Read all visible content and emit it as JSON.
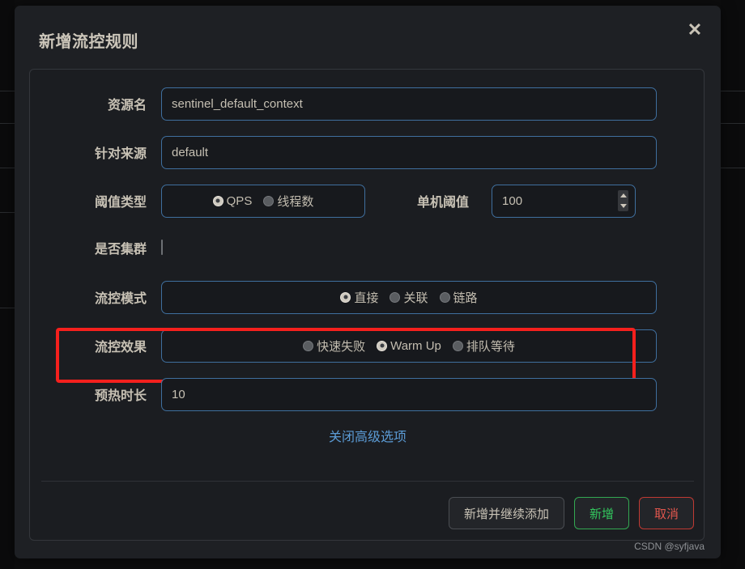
{
  "dialog": {
    "title": "新增流控规则",
    "close_icon": "close-icon"
  },
  "form": {
    "resource": {
      "label": "资源名",
      "value": "sentinel_default_context",
      "placeholder": "资源名"
    },
    "origin": {
      "label": "针对来源",
      "value": "default",
      "placeholder": "default"
    },
    "threshold_type": {
      "label": "阈值类型",
      "options": [
        {
          "label": "QPS",
          "selected": true
        },
        {
          "label": "线程数",
          "selected": false
        }
      ]
    },
    "single_threshold": {
      "label": "单机阈值",
      "value": "100",
      "spinner_up_icon": "caret-up-icon",
      "spinner_down_icon": "caret-down-icon"
    },
    "cluster": {
      "label": "是否集群",
      "checked": false
    },
    "flow_mode": {
      "label": "流控模式",
      "options": [
        {
          "label": "直接",
          "selected": true
        },
        {
          "label": "关联",
          "selected": false
        },
        {
          "label": "链路",
          "selected": false
        }
      ]
    },
    "flow_effect": {
      "label": "流控效果",
      "highlight_color": "#f5201d",
      "options": [
        {
          "label": "快速失败",
          "selected": false
        },
        {
          "label": "Warm Up",
          "selected": true
        },
        {
          "label": "排队等待",
          "selected": false
        }
      ]
    },
    "warmup_duration": {
      "label": "预热时长",
      "value": "10",
      "placeholder": "预热时长"
    },
    "advanced_toggle": {
      "label": "关闭高级选项",
      "color": "#5b9bd5"
    }
  },
  "footer": {
    "buttons": [
      {
        "label": "新增并继续添加",
        "style": "default"
      },
      {
        "label": "新增",
        "style": "primary",
        "color": "#33c75e"
      },
      {
        "label": "取消",
        "style": "danger",
        "color": "#e0564d"
      }
    ]
  },
  "watermark": {
    "text": "CSDN @syfjava"
  }
}
